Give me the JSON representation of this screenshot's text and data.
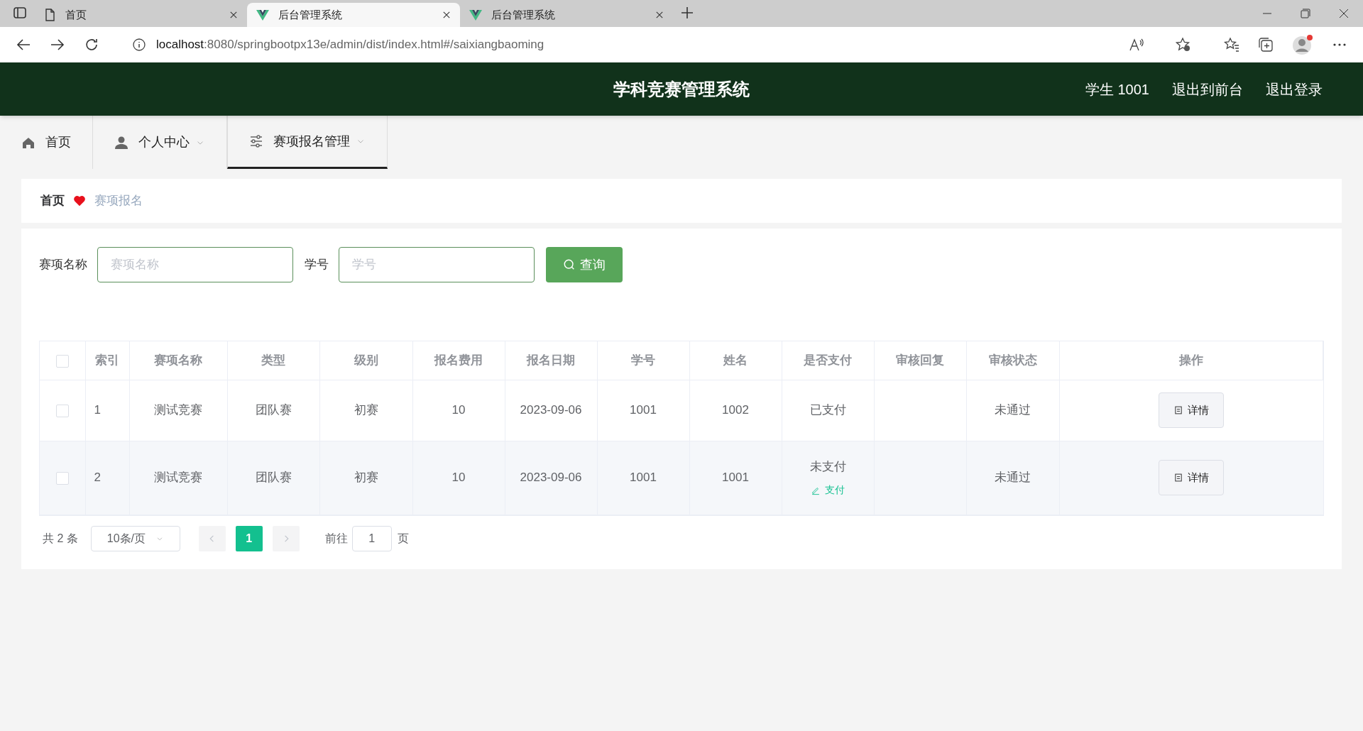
{
  "browser": {
    "tabs": [
      {
        "title": "首页",
        "kind": "page",
        "selected": false
      },
      {
        "title": "后台管理系统",
        "kind": "vue",
        "selected": true
      },
      {
        "title": "后台管理系统",
        "kind": "vue",
        "selected": false
      }
    ],
    "url_host": "localhost",
    "url_path": ":8080/springbootpx13e/admin/dist/index.html#/saixiangbaoming"
  },
  "header": {
    "title": "学科竞赛管理系统",
    "user": "学生 1001",
    "links": [
      "退出到前台",
      "退出登录"
    ]
  },
  "nav": {
    "items": [
      {
        "label": "首页",
        "kind": "home",
        "dropdown": false,
        "selected": false
      },
      {
        "label": "个人中心",
        "kind": "user",
        "dropdown": true,
        "selected": false
      },
      {
        "label": "赛项报名管理",
        "kind": "sliders",
        "dropdown": true,
        "selected": true
      }
    ]
  },
  "breadcrumb": [
    "首页",
    "赛项报名"
  ],
  "search": {
    "fields": [
      {
        "label": "赛项名称",
        "placeholder": "赛项名称"
      },
      {
        "label": "学号",
        "placeholder": "学号"
      }
    ],
    "button": "查询"
  },
  "table": {
    "header_checked": false,
    "columns": [
      "索引",
      "赛项名称",
      "类型",
      "级别",
      "报名费用",
      "报名日期",
      "学号",
      "姓名",
      "是否支付",
      "审核回复",
      "审核状态",
      "操作"
    ],
    "rows": [
      {
        "checked": false,
        "cells": [
          "1",
          "测试竞赛",
          "团队赛",
          "初赛",
          "10",
          "2023-09-06",
          "1001",
          "1002"
        ],
        "payment": {
          "status": "已支付"
        },
        "review_status": "未通过",
        "action": "详情"
      },
      {
        "checked": false,
        "cells": [
          "2",
          "测试竞赛",
          "团队赛",
          "初赛",
          "10",
          "2023-09-06",
          "1001",
          "1001"
        ],
        "payment": {
          "status": "未支付",
          "action": "支付"
        },
        "review_status": "未通过",
        "action": "详情"
      }
    ]
  },
  "pagination": {
    "total": "共 2 条",
    "page_size": "10条/页",
    "pages": [
      {
        "label": "1",
        "selected": true
      }
    ],
    "goto_label": "前往",
    "goto_value": "1",
    "page_suffix": "页"
  }
}
